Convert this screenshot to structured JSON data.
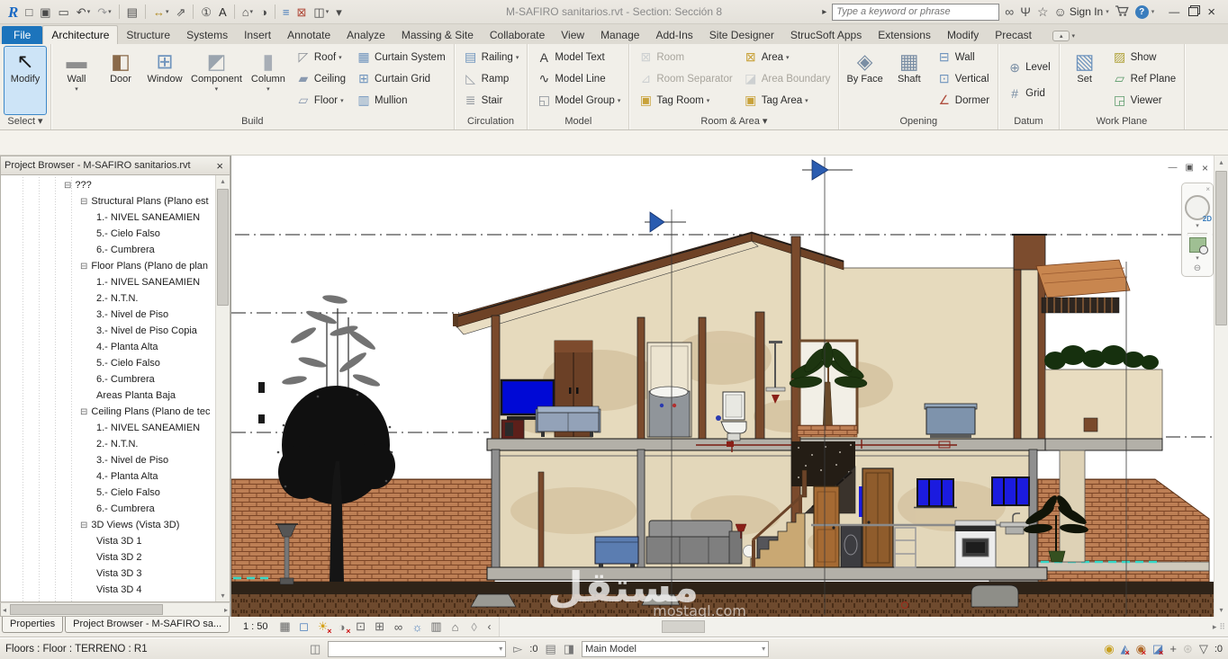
{
  "titlebar": {
    "title": "M-SAFIRO  sanitarios.rvt - Section: Sección 8",
    "search_placeholder": "Type a keyword or phrase",
    "sign_in_label": "Sign In",
    "qat": [
      {
        "n": "revit-logo",
        "g": "R",
        "c": "#1b6ac4",
        "logo": true
      },
      {
        "n": "new-file",
        "g": "□",
        "c": "#4a4a4a"
      },
      {
        "n": "save",
        "g": "▣",
        "c": "#4a4a4a"
      },
      {
        "n": "open",
        "g": "▭",
        "c": "#4a4a4a"
      },
      {
        "n": "undo",
        "g": "↶",
        "c": "#4a4a4a",
        "dd": 1
      },
      {
        "n": "redo",
        "g": "↷",
        "c": "#9a9a9a",
        "dd": 1
      },
      {
        "sep": 1
      },
      {
        "n": "print",
        "g": "▤",
        "c": "#4a4a4a"
      },
      {
        "sep": 1
      },
      {
        "n": "measure",
        "g": "↔",
        "c": "#b08a20",
        "dd": 1
      },
      {
        "n": "aligned-dimension",
        "g": "⇗",
        "c": "#4a4a4a"
      },
      {
        "sep": 1
      },
      {
        "n": "tag-by-category",
        "g": "①",
        "c": "#4a4a4a"
      },
      {
        "n": "text",
        "g": "A",
        "c": "#2a2a2a"
      },
      {
        "sep": 1
      },
      {
        "n": "default-3d-view",
        "g": "⌂",
        "c": "#4a4a4a",
        "dd": 1
      },
      {
        "n": "section",
        "g": "◑",
        "c": "#4a4a4a"
      },
      {
        "sep": 1
      },
      {
        "n": "thin-lines",
        "g": "≡",
        "c": "#4a7ebb"
      },
      {
        "n": "close-inactive-views",
        "g": "⊠",
        "c": "#b04a3a"
      },
      {
        "n": "switch-windows",
        "g": "◫",
        "c": "#4a4a4a",
        "dd": 1
      },
      {
        "n": "qat-customize",
        "g": "▾",
        "c": "#4a4a4a"
      }
    ],
    "right_icons": [
      {
        "n": "search",
        "g": "∞",
        "c": "#555"
      },
      {
        "n": "communication-center",
        "g": "Ψ",
        "c": "#555"
      },
      {
        "n": "favorites",
        "g": "☆",
        "c": "#555"
      }
    ]
  },
  "ribbon": {
    "tabs": [
      {
        "label": "File",
        "file": true
      },
      {
        "label": "Architecture",
        "active": true
      },
      {
        "label": "Structure"
      },
      {
        "label": "Systems"
      },
      {
        "label": "Insert"
      },
      {
        "label": "Annotate"
      },
      {
        "label": "Analyze"
      },
      {
        "label": "Massing & Site"
      },
      {
        "label": "Collaborate"
      },
      {
        "label": "View"
      },
      {
        "label": "Manage"
      },
      {
        "label": "Add-Ins"
      },
      {
        "label": "Site Designer"
      },
      {
        "label": "StrucSoft Apps"
      },
      {
        "label": "Extensions"
      },
      {
        "label": "Modify"
      },
      {
        "label": "Precast"
      }
    ],
    "panels": [
      {
        "name": "select",
        "label": "Select ▾",
        "big": [
          {
            "n": "modify",
            "l": "Modify",
            "sel": true
          }
        ]
      },
      {
        "name": "build",
        "label": "Build",
        "big": [
          {
            "n": "wall",
            "l": "Wall",
            "dd": 1
          },
          {
            "n": "door",
            "l": "Door"
          },
          {
            "n": "window",
            "l": "Window"
          },
          {
            "n": "component",
            "l": "Component",
            "dd": 1
          },
          {
            "n": "column",
            "l": "Column",
            "dd": 1
          }
        ],
        "cols": [
          [
            {
              "n": "roof",
              "l": "Roof",
              "dd": 1
            },
            {
              "n": "ceiling",
              "l": "Ceiling"
            },
            {
              "n": "floor",
              "l": "Floor",
              "dd": 1
            }
          ],
          [
            {
              "n": "curtain-system",
              "l": "Curtain System"
            },
            {
              "n": "curtain-grid",
              "l": "Curtain Grid"
            },
            {
              "n": "mullion",
              "l": "Mullion"
            }
          ]
        ]
      },
      {
        "name": "circulation",
        "label": "Circulation",
        "cols": [
          [
            {
              "n": "railing",
              "l": "Railing",
              "dd": 1
            },
            {
              "n": "ramp",
              "l": "Ramp"
            },
            {
              "n": "stair",
              "l": "Stair"
            }
          ]
        ]
      },
      {
        "name": "model",
        "label": "Model",
        "cols": [
          [
            {
              "n": "model-text",
              "l": "Model Text"
            },
            {
              "n": "model-line",
              "l": "Model Line"
            },
            {
              "n": "model-group",
              "l": "Model Group",
              "dd": 1
            }
          ]
        ]
      },
      {
        "name": "room-area",
        "label": "Room & Area ▾",
        "cols": [
          [
            {
              "n": "room",
              "l": "Room",
              "dis": 1
            },
            {
              "n": "room-separator",
              "l": "Room Separator",
              "dis": 1
            },
            {
              "n": "tag-room",
              "l": "Tag Room",
              "dd": 1
            }
          ],
          [
            {
              "n": "area",
              "l": "Area",
              "dd": 1
            },
            {
              "n": "area-boundary",
              "l": "Area Boundary",
              "dis": 1
            },
            {
              "n": "tag-area",
              "l": "Tag Area",
              "dd": 1
            }
          ]
        ]
      },
      {
        "name": "opening",
        "label": "Opening",
        "big": [
          {
            "n": "by-face",
            "l": "By Face"
          },
          {
            "n": "shaft",
            "l": "Shaft"
          }
        ],
        "cols": [
          [
            {
              "n": "wall-opening",
              "l": "Wall"
            },
            {
              "n": "vertical-opening",
              "l": "Vertical"
            },
            {
              "n": "dormer",
              "l": "Dormer"
            }
          ]
        ]
      },
      {
        "name": "datum",
        "label": "Datum",
        "datum": true,
        "cols": [
          [
            {
              "n": "level",
              "l": "Level"
            },
            {
              "n": "grid",
              "l": "Grid"
            }
          ]
        ]
      },
      {
        "name": "work-plane",
        "label": "Work Plane",
        "big": [
          {
            "n": "set",
            "l": "Set"
          }
        ],
        "cols": [
          [
            {
              "n": "show",
              "l": "Show"
            },
            {
              "n": "ref-plane",
              "l": "Ref Plane"
            },
            {
              "n": "viewer",
              "l": "Viewer"
            }
          ]
        ]
      }
    ]
  },
  "icons": {
    "modify": {
      "g": "↖",
      "c": "#1a1a1a"
    },
    "wall": {
      "g": "▬",
      "c": "#8f8f8f"
    },
    "door": {
      "g": "◧",
      "c": "#8a6a4a"
    },
    "window": {
      "g": "⊞",
      "c": "#6f94bd"
    },
    "component": {
      "g": "◩",
      "c": "#9aa4ae"
    },
    "column": {
      "g": "▮",
      "c": "#a8aeb6"
    },
    "roof": {
      "g": "◸",
      "c": "#8a8f96"
    },
    "ceiling": {
      "g": "▰",
      "c": "#8a9ab0"
    },
    "floor": {
      "g": "▱",
      "c": "#8a9ab0"
    },
    "curtain-system": {
      "g": "▦",
      "c": "#6f94bd"
    },
    "curtain-grid": {
      "g": "⊞",
      "c": "#6f94bd"
    },
    "mullion": {
      "g": "▥",
      "c": "#6f94bd"
    },
    "railing": {
      "g": "▤",
      "c": "#6f94bd"
    },
    "ramp": {
      "g": "◺",
      "c": "#9aa0a8"
    },
    "stair": {
      "g": "≣",
      "c": "#8a9098"
    },
    "model-text": {
      "g": "A",
      "c": "#3a3a3a"
    },
    "model-line": {
      "g": "∿",
      "c": "#3a3a3a"
    },
    "model-group": {
      "g": "◱",
      "c": "#8a8f96"
    },
    "room": {
      "g": "⊠",
      "c": "#9aa4ae"
    },
    "room-separator": {
      "g": "⊿",
      "c": "#9aa4ae"
    },
    "tag-room": {
      "g": "▣",
      "c": "#c8a23a"
    },
    "area": {
      "g": "⊠",
      "c": "#c8a23a"
    },
    "area-boundary": {
      "g": "◪",
      "c": "#9aa4ae"
    },
    "tag-area": {
      "g": "▣",
      "c": "#c8a23a"
    },
    "by-face": {
      "g": "◈",
      "c": "#7a8ea4"
    },
    "shaft": {
      "g": "▦",
      "c": "#7a8ea4"
    },
    "wall-opening": {
      "g": "⊟",
      "c": "#6f94bd"
    },
    "vertical-opening": {
      "g": "⊡",
      "c": "#6f94bd"
    },
    "dormer": {
      "g": "∠",
      "c": "#b05040"
    },
    "level": {
      "g": "⊕",
      "c": "#7a8ea4"
    },
    "grid": {
      "g": "#",
      "c": "#7a8ea4"
    },
    "set": {
      "g": "▧",
      "c": "#6f94bd"
    },
    "show": {
      "g": "▨",
      "c": "#b0a23a"
    },
    "ref-plane": {
      "g": "▱",
      "c": "#5a9a6a"
    },
    "viewer": {
      "g": "◲",
      "c": "#5a9a6a"
    }
  },
  "project_browser": {
    "title": "Project Browser - M-SAFIRO  sanitarios.rvt",
    "items": [
      {
        "t": "???",
        "lvl": 3,
        "box": true
      },
      {
        "t": "Structural Plans (Plano est",
        "lvl": 4,
        "box": true
      },
      {
        "t": "1.- NIVEL SANEAMIEN",
        "lvl": 5
      },
      {
        "t": "5.- Cielo Falso",
        "lvl": 5
      },
      {
        "t": "6.- Cumbrera",
        "lvl": 5
      },
      {
        "t": "Floor Plans (Plano de plan",
        "lvl": 4,
        "box": true
      },
      {
        "t": "1.- NIVEL SANEAMIEN",
        "lvl": 5
      },
      {
        "t": "2.- N.T.N.",
        "lvl": 5
      },
      {
        "t": "3.- Nivel de Piso",
        "lvl": 5
      },
      {
        "t": "3.- Nivel de Piso Copia",
        "lvl": 5
      },
      {
        "t": "4.- Planta Alta",
        "lvl": 5
      },
      {
        "t": "5.- Cielo Falso",
        "lvl": 5
      },
      {
        "t": "6.- Cumbrera",
        "lvl": 5
      },
      {
        "t": "Areas Planta Baja",
        "lvl": 5
      },
      {
        "t": "Ceiling Plans (Plano de tec",
        "lvl": 4,
        "box": true
      },
      {
        "t": "1.- NIVEL SANEAMIEN",
        "lvl": 5
      },
      {
        "t": "2.- N.T.N.",
        "lvl": 5
      },
      {
        "t": "3.- Nivel de Piso",
        "lvl": 5
      },
      {
        "t": "4.- Planta Alta",
        "lvl": 5
      },
      {
        "t": "5.- Cielo Falso",
        "lvl": 5
      },
      {
        "t": "6.- Cumbrera",
        "lvl": 5
      },
      {
        "t": "3D Views (Vista 3D)",
        "lvl": 4,
        "box": true
      },
      {
        "t": "Vista 3D 1",
        "lvl": 5
      },
      {
        "t": "Vista 3D 2",
        "lvl": 5
      },
      {
        "t": "Vista 3D 3",
        "lvl": 5
      },
      {
        "t": "Vista 3D 4",
        "lvl": 5
      }
    ]
  },
  "bottom_tabs": [
    "Properties",
    "Project Browser - M-SAFIRO  sa..."
  ],
  "view_bar": {
    "scale": "1 : 50",
    "icons": [
      {
        "n": "detail-level",
        "g": "▦",
        "c": "#666"
      },
      {
        "n": "visual-style",
        "g": "◻",
        "c": "#4a7ebb"
      },
      {
        "n": "sun-path",
        "g": "☀",
        "c": "#d4a017",
        "x": 1
      },
      {
        "n": "shadows",
        "g": "◑",
        "c": "#777",
        "x": 1
      },
      {
        "n": "crop-view",
        "g": "⊡",
        "c": "#666"
      },
      {
        "n": "show-crop-region",
        "g": "⊞",
        "c": "#666"
      },
      {
        "n": "temporary-hide-isolate",
        "g": "∞",
        "c": "#555"
      },
      {
        "n": "reveal-hidden-elements",
        "g": "☼",
        "c": "#4a7ebb"
      },
      {
        "n": "temporary-view-properties",
        "g": "▥",
        "c": "#666"
      },
      {
        "n": "hide-analytical-model",
        "g": "⌂",
        "c": "#666"
      },
      {
        "n": "reveal-constraints",
        "g": "◊",
        "c": "#999"
      }
    ]
  },
  "status_bar": {
    "selection_info": "Floors : Floor : TERRENO : R1",
    "worksets_value": "",
    "editing_requests": ":0",
    "design_option": "Main Model",
    "filter_count": ":0",
    "right_icons": [
      {
        "n": "select-links",
        "g": "◉",
        "c": "#c8a020"
      },
      {
        "n": "select-underlay-elements",
        "g": "◭",
        "c": "#5580bb",
        "x": 1
      },
      {
        "n": "select-pinned-elements",
        "g": "◉",
        "c": "#b06a2a",
        "x": 1
      },
      {
        "n": "select-elements-by-face",
        "g": "◪",
        "c": "#5580bb",
        "x": 1
      },
      {
        "n": "drag-elements-on-selection",
        "g": "+",
        "c": "#555"
      },
      {
        "n": "settings-gear",
        "g": "⊛",
        "c": "#c2c0ba"
      },
      {
        "n": "filters",
        "g": "▽",
        "c": "#555"
      }
    ]
  },
  "canvas": {
    "watermark": "مستقل",
    "watermark_domain": "mostaql.com"
  }
}
